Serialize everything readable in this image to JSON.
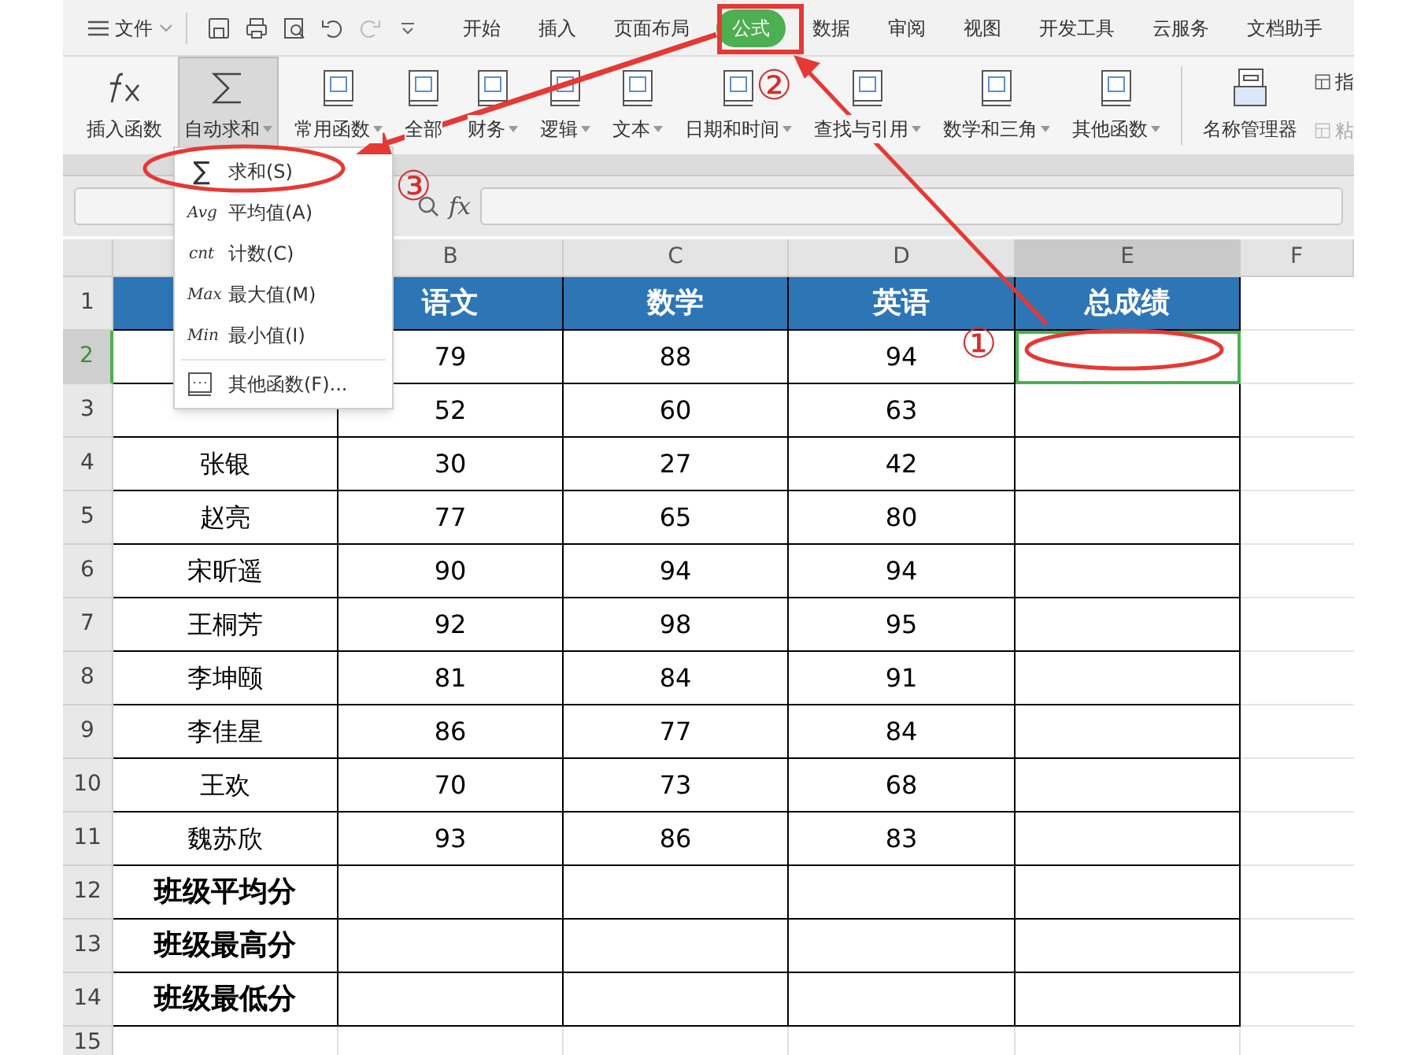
{
  "menu_bar": {
    "file_menu": "文件",
    "tabs": [
      {
        "label": "开始",
        "selected": false
      },
      {
        "label": "插入",
        "selected": false
      },
      {
        "label": "页面布局",
        "selected": false
      },
      {
        "label": "公式",
        "selected": true
      },
      {
        "label": "数据",
        "selected": false
      },
      {
        "label": "审阅",
        "selected": false
      },
      {
        "label": "视图",
        "selected": false
      },
      {
        "label": "开发工具",
        "selected": false
      },
      {
        "label": "云服务",
        "selected": false
      },
      {
        "label": "文档助手",
        "selected": false
      }
    ]
  },
  "ribbon": {
    "buttons": [
      {
        "kind": "fx",
        "label": "插入函数",
        "dropdown": false,
        "pressed": false
      },
      {
        "kind": "sigma",
        "label": "自动求和",
        "dropdown": true,
        "pressed": true
      },
      {
        "kind": "book",
        "label": "常用函数",
        "dropdown": true,
        "pressed": false
      },
      {
        "kind": "book",
        "label": "全部",
        "dropdown": false,
        "pressed": false
      },
      {
        "kind": "book",
        "label": "财务",
        "dropdown": true,
        "pressed": false
      },
      {
        "kind": "book",
        "label": "逻辑",
        "dropdown": true,
        "pressed": false
      },
      {
        "kind": "book",
        "label": "文本",
        "dropdown": true,
        "pressed": false
      },
      {
        "kind": "book",
        "label": "日期和时间",
        "dropdown": true,
        "pressed": false
      },
      {
        "kind": "book",
        "label": "查找与引用",
        "dropdown": true,
        "pressed": false
      },
      {
        "kind": "book",
        "label": "数学和三角",
        "dropdown": true,
        "pressed": false
      },
      {
        "kind": "book",
        "label": "其他函数",
        "dropdown": true,
        "pressed": false
      },
      {
        "kind": "names",
        "label": "名称管理器",
        "dropdown": false,
        "pressed": false
      }
    ],
    "small_buttons": [
      {
        "label": "指",
        "disabled": false
      },
      {
        "label": "粘",
        "disabled": true
      }
    ]
  },
  "autosum_menu": [
    {
      "kind": "glyph",
      "icon": "∑",
      "label": "求和(S)"
    },
    {
      "kind": "glyph",
      "icon": "Avg",
      "label": "平均值(A)"
    },
    {
      "kind": "glyph",
      "icon": "cnt",
      "label": "计数(C)"
    },
    {
      "kind": "glyph",
      "icon": "Max",
      "label": "最大值(M)"
    },
    {
      "kind": "glyph",
      "icon": "Min",
      "label": "最小值(I)"
    },
    {
      "kind": "more",
      "label": "其他函数(F)..."
    }
  ],
  "formula_bar": {
    "fx": "fx"
  },
  "sheet": {
    "columns": [
      {
        "label": "B",
        "selected": false
      },
      {
        "label": "C",
        "selected": false
      },
      {
        "label": "D",
        "selected": false
      },
      {
        "label": "E",
        "selected": true
      },
      {
        "label": "F",
        "selected": false
      }
    ],
    "rows": [
      {
        "number": "1",
        "kind": "header",
        "selected": false,
        "cells": [
          "语文",
          "数学",
          "英语",
          "总成绩"
        ]
      },
      {
        "number": "2",
        "kind": "data",
        "selected": true,
        "cells": [
          "79",
          "88",
          "94",
          null
        ]
      },
      {
        "number": "3",
        "kind": "data",
        "selected": false,
        "cells": [
          "52",
          "60",
          "63",
          null
        ]
      },
      {
        "number": "4",
        "kind": "data",
        "selected": false,
        "name": "张银",
        "cells": [
          "30",
          "27",
          "42",
          null
        ]
      },
      {
        "number": "5",
        "kind": "data",
        "selected": false,
        "name": "赵亮",
        "cells": [
          "77",
          "65",
          "80",
          null
        ]
      },
      {
        "number": "6",
        "kind": "data",
        "selected": false,
        "name": "宋昕遥",
        "cells": [
          "90",
          "94",
          "94",
          null
        ]
      },
      {
        "number": "7",
        "kind": "data",
        "selected": false,
        "name": "王桐芳",
        "cells": [
          "92",
          "98",
          "95",
          null
        ]
      },
      {
        "number": "8",
        "kind": "data",
        "selected": false,
        "name": "李坤颐",
        "cells": [
          "81",
          "84",
          "91",
          null
        ]
      },
      {
        "number": "9",
        "kind": "data",
        "selected": false,
        "name": "李佳星",
        "cells": [
          "86",
          "77",
          "84",
          null
        ]
      },
      {
        "number": "10",
        "kind": "data",
        "selected": false,
        "name": "王欢",
        "cells": [
          "70",
          "73",
          "68",
          null
        ]
      },
      {
        "number": "11",
        "kind": "data",
        "selected": false,
        "name": "魏苏欣",
        "cells": [
          "93",
          "86",
          "83",
          null
        ]
      },
      {
        "number": "12",
        "kind": "summary",
        "selected": false,
        "name": "班级平均分",
        "cells": [
          null,
          null,
          null,
          null
        ]
      },
      {
        "number": "13",
        "kind": "summary",
        "selected": false,
        "name": "班级最高分",
        "cells": [
          null,
          null,
          null,
          null
        ]
      },
      {
        "number": "14",
        "kind": "summary",
        "selected": false,
        "name": "班级最低分",
        "cells": [
          null,
          null,
          null,
          null
        ]
      },
      {
        "number": "15",
        "kind": "empty",
        "selected": false,
        "cells": [
          null,
          null,
          null,
          null
        ]
      }
    ]
  },
  "callouts": [
    "①",
    "②",
    "③"
  ]
}
